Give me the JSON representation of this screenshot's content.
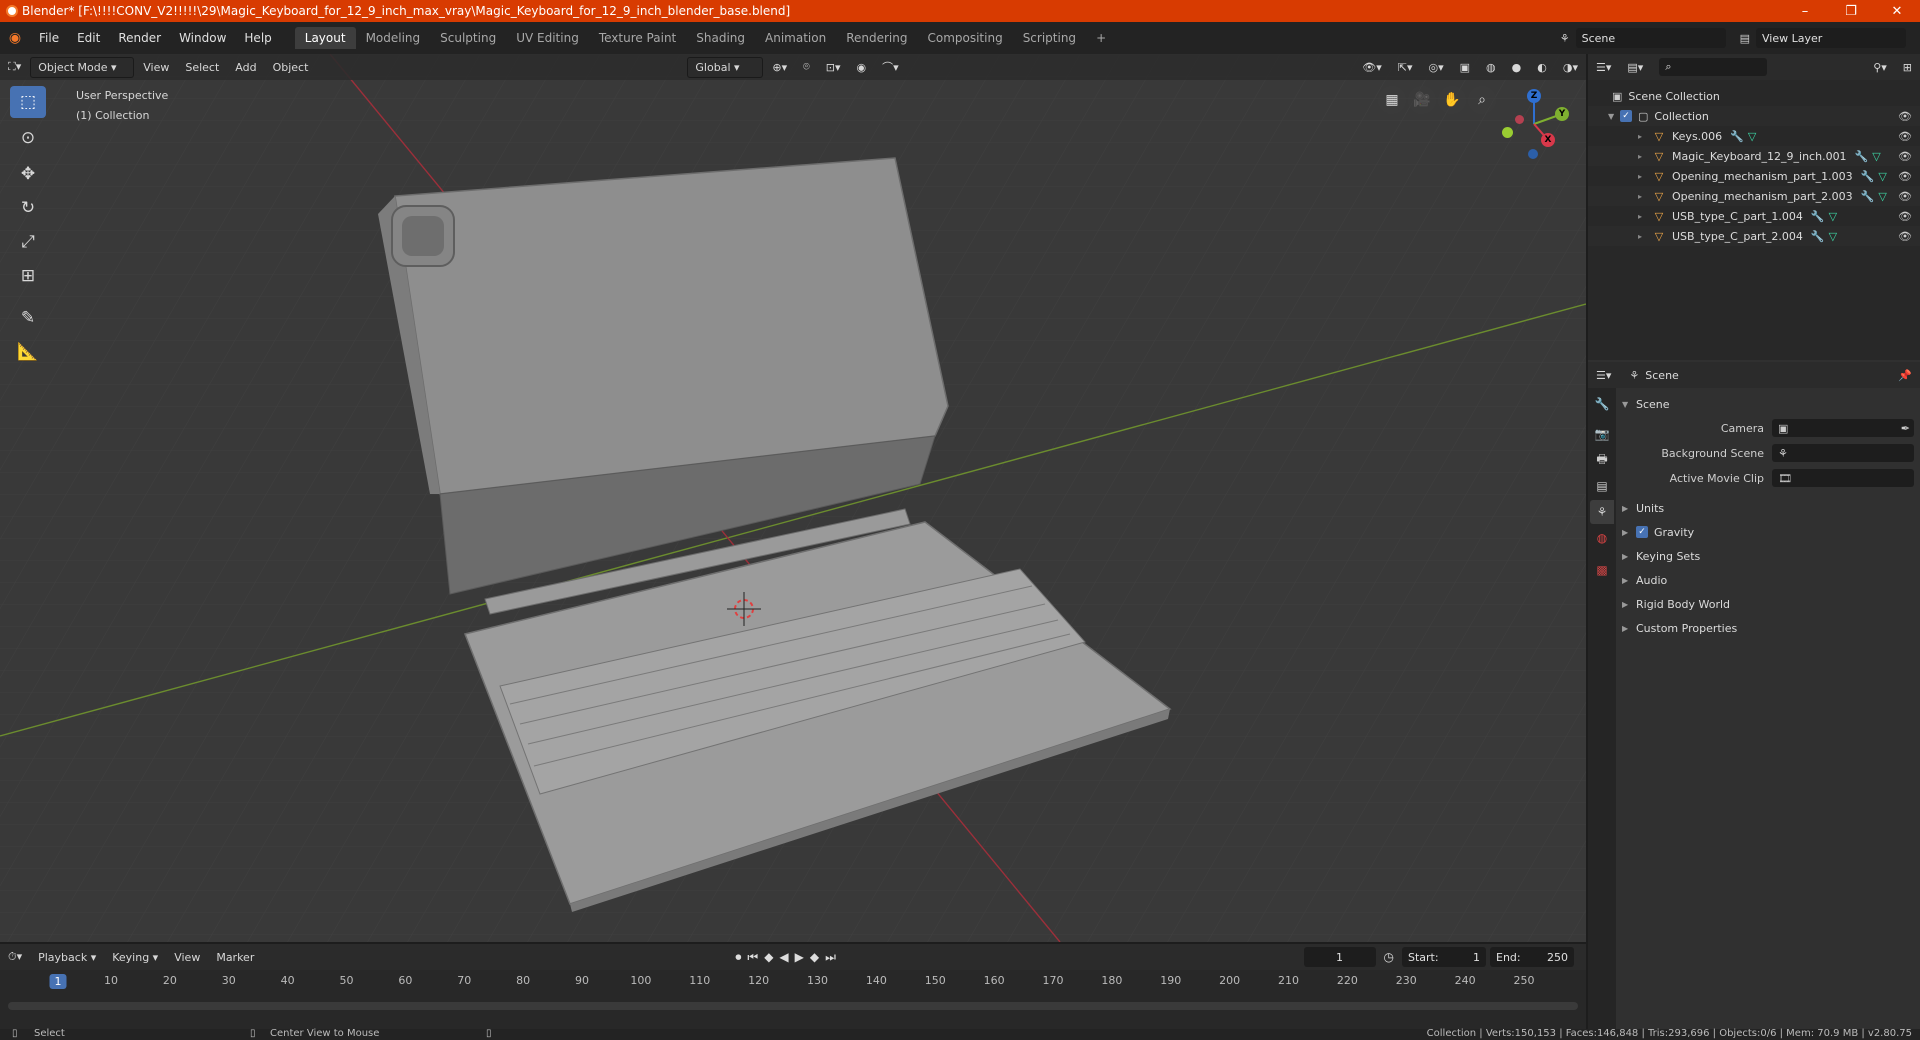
{
  "window": {
    "title": "Blender* [F:\\!!!!CONV_V2!!!!!\\29\\Magic_Keyboard_for_12_9_inch_max_vray\\Magic_Keyboard_for_12_9_inch_blender_base.blend]",
    "minimize": "–",
    "maximize": "❐",
    "close": "✕"
  },
  "menu": [
    "File",
    "Edit",
    "Render",
    "Window",
    "Help"
  ],
  "workspaces": [
    "Layout",
    "Modeling",
    "Sculpting",
    "UV Editing",
    "Texture Paint",
    "Shading",
    "Animation",
    "Rendering",
    "Compositing",
    "Scripting"
  ],
  "workspace_add": "+",
  "scene_field": "Scene",
  "view_layer_field": "View Layer",
  "viewport": {
    "mode": "Object Mode",
    "menus": [
      "View",
      "Select",
      "Add",
      "Object"
    ],
    "transform_orientation": "Global",
    "perspective": "User Perspective",
    "collection": "(1) Collection",
    "gizmo": {
      "z": "Z",
      "y": "Y",
      "x": "X"
    }
  },
  "outliner": {
    "root": "Scene Collection",
    "collection": "Collection",
    "items": [
      "Keys.006",
      "Magic_Keyboard_12_9_inch.001",
      "Opening_mechanism_part_1.003",
      "Opening_mechanism_part_2.003",
      "USB_type_C_part_1.004",
      "USB_type_C_part_2.004"
    ]
  },
  "properties": {
    "header": "Scene",
    "panel": "Scene",
    "camera_label": "Camera",
    "background_label": "Background Scene",
    "movie_clip_label": "Active Movie Clip",
    "sections": [
      "Units",
      "Gravity",
      "Keying Sets",
      "Audio",
      "Rigid Body World",
      "Custom Properties"
    ]
  },
  "timeline": {
    "menus": [
      "Playback",
      "Keying",
      "View",
      "Marker"
    ],
    "current_frame": "1",
    "start_label": "Start:",
    "start": "1",
    "end_label": "End:",
    "end": "250",
    "ticks": [
      "1",
      "10",
      "20",
      "30",
      "40",
      "50",
      "60",
      "70",
      "80",
      "90",
      "100",
      "110",
      "120",
      "130",
      "140",
      "150",
      "160",
      "170",
      "180",
      "190",
      "200",
      "210",
      "220",
      "230",
      "240",
      "250"
    ]
  },
  "status": {
    "select": "Select",
    "center": "Center View to Mouse",
    "stats": "Collection | Verts:150,153 | Faces:146,848 | Tris:293,696 | Objects:0/6 | Mem: 70.9 MB | v2.80.75"
  }
}
